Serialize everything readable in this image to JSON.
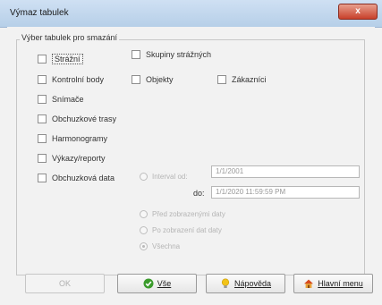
{
  "window": {
    "title": "Výmaz tabulek",
    "close_glyph": "x"
  },
  "group": {
    "legend": "Výber tabulek pro smazání"
  },
  "checkboxes": {
    "strazni": "Strážní",
    "skupiny": "Skupiny strážných",
    "kontrolni_body": "Kontrolní body",
    "objekty": "Objekty",
    "zakaznici": "Zákazníci",
    "snimace": "Snímače",
    "obchuzkove_trasy": "Obchuzkové trasy",
    "harmonogramy": "Harmonogramy",
    "vykazy_reporty": "Výkazy/reporty",
    "obchuzkova_data": "Obchuzková data"
  },
  "date_range": {
    "interval_label": "Interval od:",
    "from_value": "1/1/2001",
    "to_label": "do:",
    "to_value": "1/1/2020 11:59:59 PM"
  },
  "radio_options": [
    "Před zobrazenými daty",
    "Po zobrazení dat daty",
    "Všechna"
  ],
  "buttons": {
    "ok": "OK",
    "vse": "Vše",
    "napoveda": "Nápověda",
    "hlavni_menu": "Hlavní menu"
  },
  "colors": {
    "titlebar": "#c4d8ee",
    "close": "#c8402a",
    "vse_icon": "#3a9b2b",
    "help_icon": "#f2c318",
    "home_icon": "#d64a1e"
  }
}
